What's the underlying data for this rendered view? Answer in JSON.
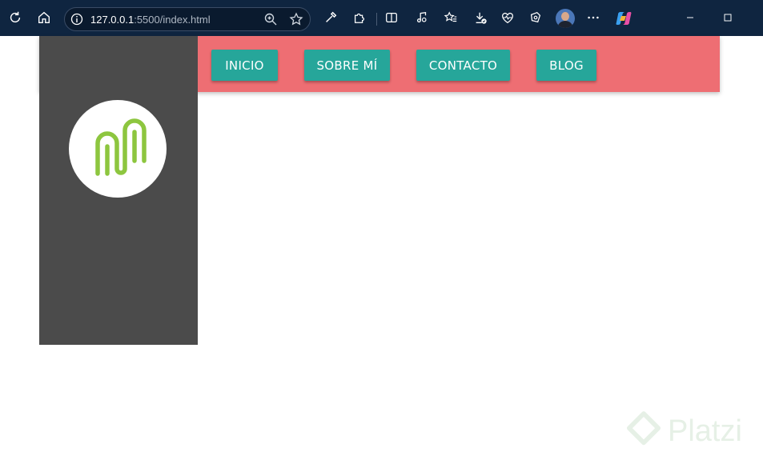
{
  "browser": {
    "url_host": "127.0.0.1",
    "url_rest": ":5500/index.html"
  },
  "nav": {
    "items": [
      {
        "label": "INICIO"
      },
      {
        "label": "SOBRE MÍ"
      },
      {
        "label": "CONTACTO"
      },
      {
        "label": "BLOG"
      }
    ]
  },
  "watermark": {
    "text": "Platzi"
  },
  "colors": {
    "toolbar": "#0f2540",
    "navbar": "#ee6e73",
    "nav_button": "#26a69a",
    "sidebar": "#4b4b4b",
    "logo_stroke": "#8dc63f"
  }
}
